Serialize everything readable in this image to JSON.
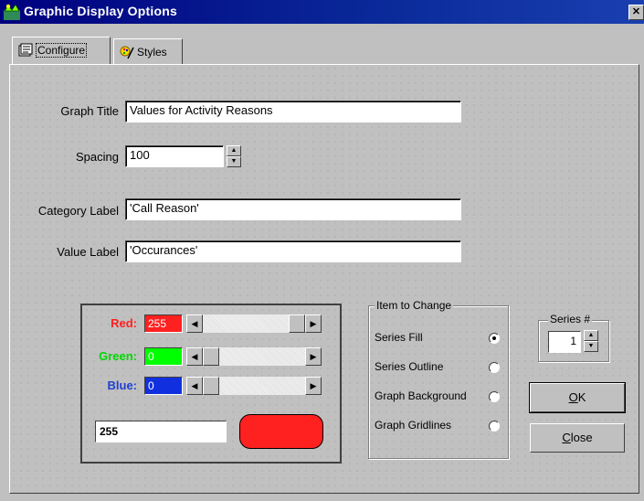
{
  "window": {
    "title": "Graphic Display Options",
    "close_glyph": "✕"
  },
  "tabs": [
    {
      "label": "Configure",
      "icon": "configure-icon",
      "active": true
    },
    {
      "label": "Styles",
      "icon": "styles-icon",
      "active": false
    }
  ],
  "form": {
    "graph_title_label": "Graph Title",
    "graph_title_value": "Values for Activity Reasons",
    "spacing_label": "Spacing",
    "spacing_value": "100",
    "category_label_label": "Category Label",
    "category_label_value": "'Call Reason'",
    "value_label_label": "Value Label",
    "value_label_value": "'Occurances'"
  },
  "color_editor": {
    "red_label": "Red:",
    "red_value": "255",
    "green_label": "Green:",
    "green_value": "0",
    "blue_label": "Blue:",
    "blue_value": "0",
    "hex_value": "255",
    "colors": {
      "red": "#ff0000",
      "green": "#00ff00",
      "blue": "#0000ff",
      "swatch": "#ff2020"
    }
  },
  "item_to_change": {
    "legend": "Item to Change",
    "options": [
      {
        "label": "Series Fill",
        "selected": true
      },
      {
        "label": "Series Outline",
        "selected": false
      },
      {
        "label": "Graph Background",
        "selected": false
      },
      {
        "label": "Graph Gridlines",
        "selected": false
      }
    ]
  },
  "series": {
    "legend": "Series #",
    "value": "1"
  },
  "buttons": {
    "ok_mnemonic": "O",
    "ok_rest": "K",
    "close_mnemonic": "C",
    "close_rest": "lose"
  }
}
